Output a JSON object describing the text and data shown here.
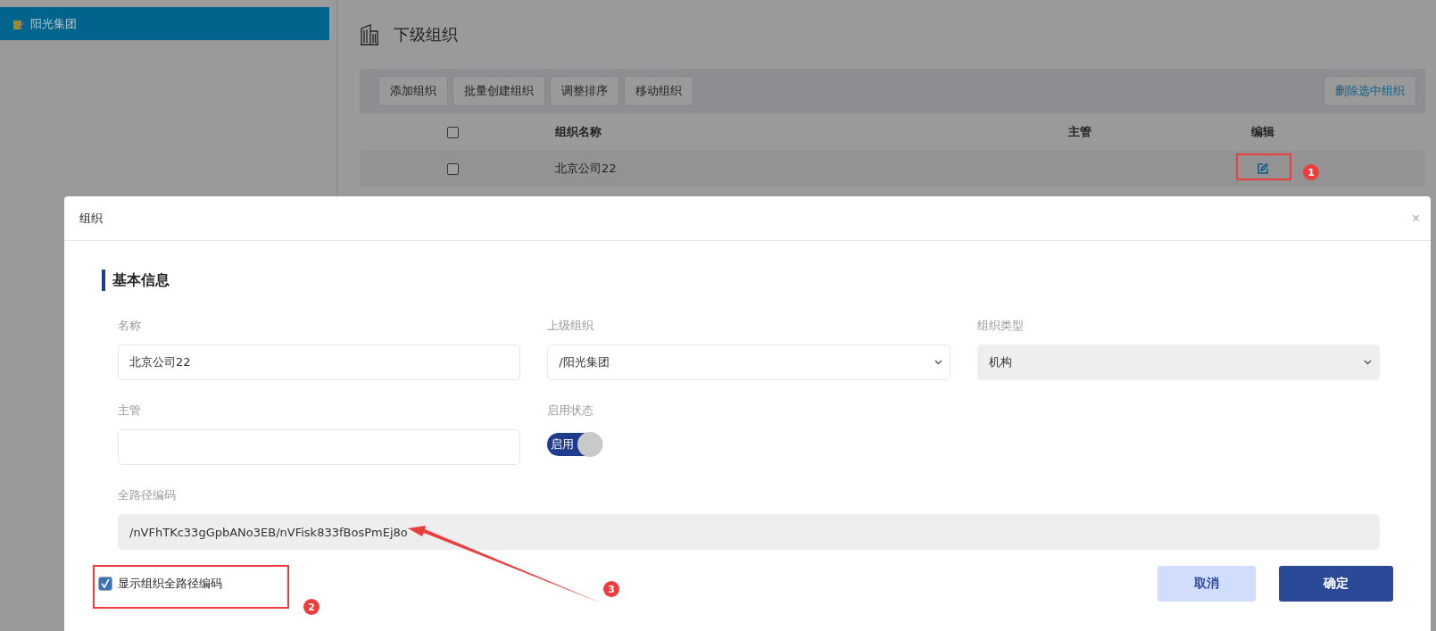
{
  "sidebar": {
    "items": [
      {
        "label": "阳光集团",
        "selected": true
      }
    ]
  },
  "main": {
    "title": "下级组织",
    "toolbar": {
      "buttons": [
        "添加组织",
        "批量创建组织",
        "调整排序",
        "移动组织"
      ],
      "delete_button": "删除选中组织"
    },
    "table": {
      "columns": [
        "组织名称",
        "主管",
        "编辑"
      ],
      "header_checked": false,
      "rows": [
        {
          "name": "北京公司22",
          "checked": false
        }
      ]
    }
  },
  "dialog": {
    "title": "组织",
    "close": "×",
    "section": "基本信息",
    "fields": [
      {
        "kind": "text",
        "label": "名称",
        "value": "北京公司22"
      },
      {
        "kind": "select",
        "label": "上级组织",
        "value": "/阳光集团",
        "disabled": false
      },
      {
        "kind": "select",
        "label": "组织类型",
        "value": "机构",
        "disabled": true
      },
      {
        "kind": "text",
        "label": "主管"
      },
      {
        "kind": "toggle",
        "label": "启用状态",
        "on": true,
        "text": "启用"
      },
      {
        "kind": "readonly",
        "label": "全路径编码",
        "value": "/nVFhTKc33gGpbANo3EB/nVFisk833fBosPmEj8o"
      }
    ],
    "checkbox": {
      "label": "显示组织全路径编码",
      "checked": true
    },
    "buttons": [
      {
        "label": "取消",
        "kind": "secondary"
      },
      {
        "label": "确定",
        "kind": "primary"
      }
    ]
  },
  "annotations": [
    {
      "number": "1"
    },
    {
      "number": "2"
    },
    {
      "number": "3"
    }
  ]
}
